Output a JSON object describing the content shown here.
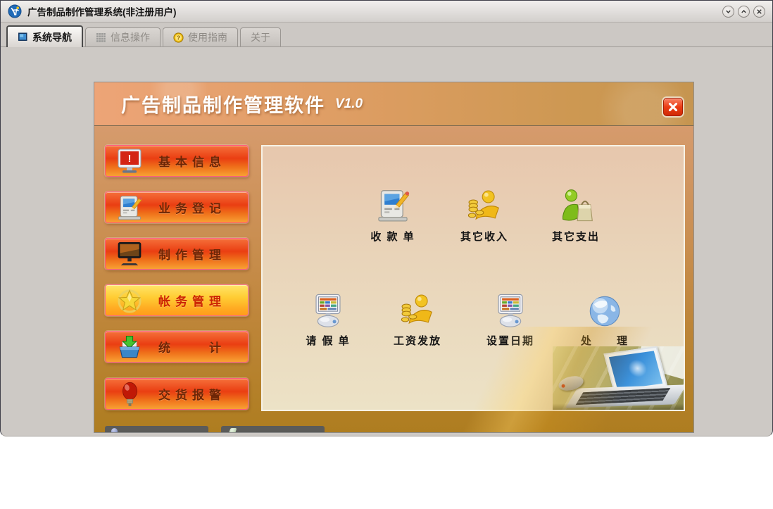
{
  "window": {
    "title": "广告制品制作管理系统(非注册用户)",
    "app_icon": "blue-globe-logo",
    "controls": [
      {
        "name": "shade",
        "icon": "chevron-down-icon"
      },
      {
        "name": "unshade",
        "icon": "chevron-up-icon"
      },
      {
        "name": "close",
        "icon": "x-icon"
      }
    ]
  },
  "tabs": [
    {
      "label": "系统导航",
      "icon": "blue-square-icon",
      "active": true
    },
    {
      "label": "信息操作",
      "icon": "grid-icon",
      "active": false
    },
    {
      "label": "使用指南",
      "icon": "help-coin-icon",
      "active": false
    },
    {
      "label": "关于",
      "icon": "",
      "active": false
    }
  ],
  "panel": {
    "title": "广告制品制作管理软件",
    "version": "V1.0",
    "close_icon": "x-icon",
    "sidebar": {
      "items": [
        {
          "label": "基本信息",
          "icon": "monitor-alert-icon",
          "highlighted": false
        },
        {
          "label": "业务登记",
          "icon": "computer-pencil-icon",
          "highlighted": false
        },
        {
          "label": "制作管理",
          "icon": "flat-monitor-icon",
          "highlighted": false
        },
        {
          "label": "帐务管理",
          "icon": "gold-star-icon",
          "highlighted": true
        },
        {
          "label": "统　　计",
          "icon": "archive-download-icon",
          "highlighted": false
        },
        {
          "label": "交货报警",
          "icon": "red-bulb-icon",
          "highlighted": false
        }
      ]
    },
    "shortcuts": {
      "row1": [
        {
          "label": "收 款 单",
          "icon": "computer-pencil-icon"
        },
        {
          "label": "其它收入",
          "icon": "person-coins-icon"
        },
        {
          "label": "其它支出",
          "icon": "person-bag-icon"
        }
      ],
      "row2": [
        {
          "label": "请 假 单",
          "icon": "computer-calendar-icon"
        },
        {
          "label": "工资发放",
          "icon": "person-coins-icon"
        },
        {
          "label": "设置日期",
          "icon": "computer-calendar-icon"
        },
        {
          "label": "处　　理",
          "icon": "globe-icon"
        }
      ]
    }
  },
  "colors": {
    "sidebar_button_red": "#ea3e12",
    "sidebar_button_yellow": "#ffcd34",
    "panel_header": "#dd9d62",
    "panel_body_gold": "#ae7d20",
    "content_bg": "#ecdfc4",
    "close_button_red": "#ea3c14"
  }
}
